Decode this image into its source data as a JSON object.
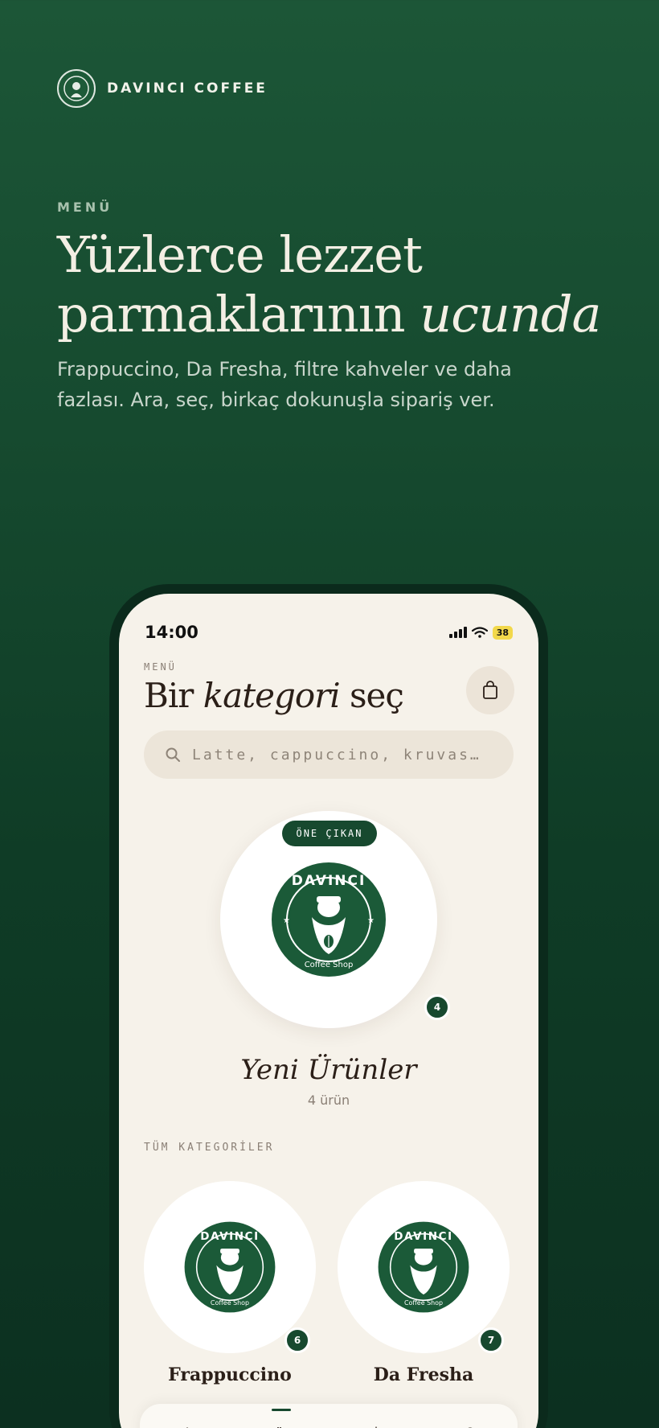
{
  "brand": {
    "name": "DAVINCI COFFEE"
  },
  "hero": {
    "eyebrow": "MENÜ",
    "title_line1": "Yüzlerce lezzet",
    "title_line2_plain": "parmaklarının",
    "title_line2_italic": "ucunda",
    "subtitle": "Frappuccino, Da Fresha, filtre kahveler ve daha fazlası. Ara, seç, birkaç dokunuşla sipariş ver."
  },
  "phone": {
    "status": {
      "time": "14:00",
      "battery": "38"
    },
    "eyebrow": "MENÜ",
    "title_part1": "Bir",
    "title_italic": "kategori",
    "title_part2": "seç",
    "search": {
      "placeholder": "Latte, cappuccino, kruvas…"
    },
    "featured": {
      "tag": "ÖNE ÇIKAN",
      "name": "Yeni Ürünler",
      "count": "4",
      "count_label": "4 ürün"
    },
    "categories_label": "TÜM KATEGORİLER",
    "categories": [
      {
        "name": "Frappuccino",
        "count": "6"
      },
      {
        "name": "Da Fresha",
        "count": "7"
      }
    ],
    "tabs": [
      "home-icon",
      "coffee-cup-icon",
      "sparkle-icon",
      "profile-icon"
    ],
    "active_tab": 1
  },
  "logo_text": {
    "top": "DAVINCI",
    "bottom": "Coffee Shop"
  },
  "colors": {
    "brand_green": "#17492f",
    "cream": "#f6f2ea",
    "ink": "#2b1f18"
  }
}
